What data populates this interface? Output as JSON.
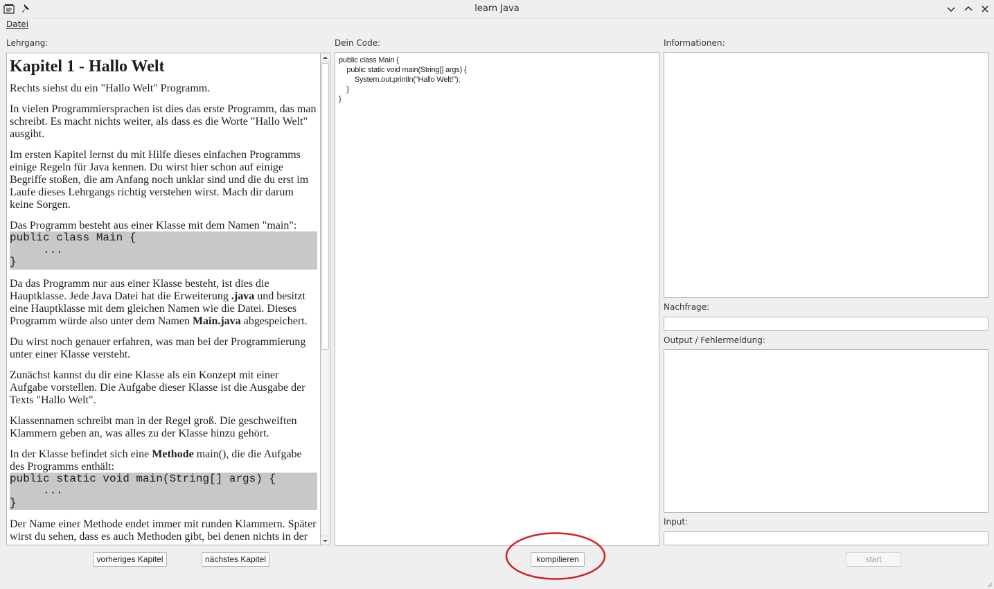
{
  "window": {
    "title": "learn Java",
    "icons": [
      "app-icon",
      "pin-icon",
      "minimize-icon",
      "maximize-icon",
      "close-icon"
    ]
  },
  "menu": {
    "items": [
      {
        "label": "Datei"
      }
    ]
  },
  "left": {
    "label": "Lehrgang:",
    "heading": "Kapitel 1 - Hallo Welt",
    "p1": "Rechts siehst du ein \"Hallo Welt\" Programm.",
    "p2": "In vielen Programmiersprachen ist dies das erste Programm, das man schreibt. Es macht nichts weiter, als dass es die Worte \"Hallo Welt\" ausgibt.",
    "p3": "Im ersten Kapitel lernst du mit Hilfe dieses einfachen Programms einige Regeln für Java kennen. Du wirst hier schon auf einige Begriffe stoßen, die am Anfang noch unklar sind und die du erst im Laufe dieses Lehrgangs richtig verstehen wirst. Mach dir darum keine Sorgen.",
    "p4": "Das Programm besteht aus einer Klasse mit dem Namen \"main\":",
    "code1": "public class Main {\n     ...\n}",
    "p5_a": "Da das Programm nur aus einer Klasse besteht, ist dies die Hauptklasse. Jede Java Datei hat die Erweiterung ",
    "p5_b": ".java",
    "p5_c": " und besitzt eine Hauptklasse mit dem gleichen Namen wie die Datei. Dieses Programm würde also unter dem Namen ",
    "p5_d": "Main.java",
    "p5_e": " abgespeichert.",
    "p6": "Du wirst noch genauer erfahren, was man bei der Programmierung unter einer Klasse versteht.",
    "p7": "Zunächst kannst du dir eine Klasse als ein Konzept mit einer Aufgabe vorstellen. Die Aufgabe dieser Klasse ist die Ausgabe der Texts \"Hallo Welt\".",
    "p8": "Klassennamen schreibt man in der Regel groß. Die geschweiften Klammern geben an, was alles zu der Klasse hinzu gehört.",
    "p9_a": "In der Klasse befindet sich eine ",
    "p9_b": "Methode",
    "p9_c": " main(), die die Aufgabe des Programms enthält:",
    "code2": "public static void main(String[] args) {\n     ...\n}",
    "p10": "Der Name einer Methode endet immer mit runden Klammern. Später wirst du sehen, dass es auch Methoden gibt, bei denen nichts in der",
    "btn_prev": "vorheriges Kapitel",
    "btn_next": "nächstes Kapitel"
  },
  "middle": {
    "label": "Dein Code:",
    "code": "public class Main {\n    public static void main(String[] args) {\n        System.out.println(\"Hallo Welt!\");\n    }\n}",
    "btn_compile": "kompilieren"
  },
  "right": {
    "info_label": "Informationen:",
    "info_value": "",
    "nachfrage_label": "Nachfrage:",
    "nachfrage_value": "",
    "output_label": "Output / Fehlermeldung:",
    "output_value": "",
    "input_label": "Input:",
    "input_value": "",
    "btn_start": "start"
  },
  "colors": {
    "annotation": "#d42020",
    "code_bg": "#c8c8c8"
  }
}
